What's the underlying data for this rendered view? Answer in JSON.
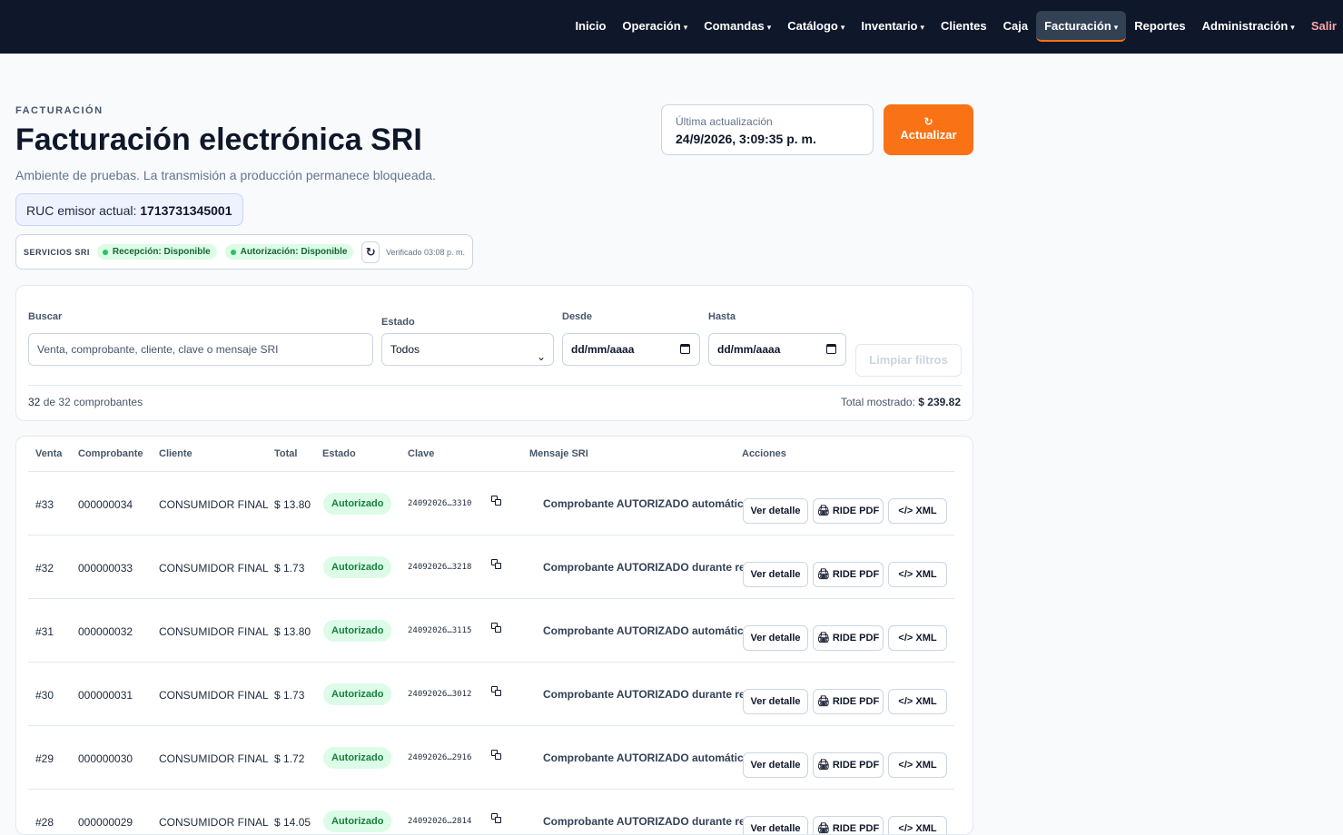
{
  "nav": {
    "items": [
      {
        "label": "Inicio",
        "caret": false
      },
      {
        "label": "Operación",
        "caret": true
      },
      {
        "label": "Comandas",
        "caret": true
      },
      {
        "label": "Catálogo",
        "caret": true
      },
      {
        "label": "Inventario",
        "caret": true
      },
      {
        "label": "Clientes",
        "caret": false
      },
      {
        "label": "Caja",
        "caret": false
      },
      {
        "label": "Facturación",
        "caret": true,
        "active": true
      },
      {
        "label": "Reportes",
        "caret": false
      },
      {
        "label": "Administración",
        "caret": true
      },
      {
        "label": "Salir",
        "caret": false
      }
    ]
  },
  "header": {
    "eyebrow": "FACTURACIÓN",
    "title": "Facturación electrónica SRI",
    "subtitle": "Ambiente de pruebas. La transmisión a producción permanece bloqueada.",
    "last_update_label": "Última actualización",
    "last_update_value": "24/9/2026, 3:09:35 p. m.",
    "refresh_symbol": "↻",
    "refresh_label": "Actualizar"
  },
  "ruc": {
    "label": "RUC emisor actual:",
    "value": "1713731345001"
  },
  "services": {
    "title": "SERVICIOS SRI",
    "reception": "Recepción: Disponible",
    "authorization": "Autorización: Disponible",
    "refresh_symbol": "↻",
    "verified": "Verificado 03:08 p. m."
  },
  "filters": {
    "search_label": "Buscar",
    "search_placeholder": "Venta, comprobante, cliente, clave o mensaje SRI",
    "status_label": "Estado",
    "status_value": "Todos",
    "from_label": "Desde",
    "from_value": "dd/mm/aaaa",
    "to_label": "Hasta",
    "to_value": "dd/mm/aaaa",
    "clear_label": "Limpiar filtros",
    "count_shown": "32",
    "count_rest": "de 32 comprobantes",
    "total_label": "Total mostrado:",
    "total_value": "$ 239.82"
  },
  "table": {
    "headers": {
      "venta": "Venta",
      "comprobante": "Comprobante",
      "cliente": "Cliente",
      "total": "Total",
      "estado": "Estado",
      "clave": "Clave",
      "mensaje": "Mensaje SRI",
      "acciones": "Acciones"
    },
    "actions": {
      "detail": "Ver detalle",
      "ride": "🖨 RIDE PDF",
      "xml": "</> XML"
    },
    "rows": [
      {
        "venta": "#33",
        "comprobante": "000000034",
        "cliente": "CONSUMIDOR FINAL",
        "total": "$ 13.80",
        "estado": "Autorizado",
        "clave": "24092026…3310",
        "mensaje": "Comprobante AUTORIZADO automáticamente"
      },
      {
        "venta": "#32",
        "comprobante": "000000033",
        "cliente": "CONSUMIDOR FINAL",
        "total": "$ 1.73",
        "estado": "Autorizado",
        "clave": "24092026…3218",
        "mensaje": "Comprobante AUTORIZADO durante reintento"
      },
      {
        "venta": "#31",
        "comprobante": "000000032",
        "cliente": "CONSUMIDOR FINAL",
        "total": "$ 13.80",
        "estado": "Autorizado",
        "clave": "24092026…3115",
        "mensaje": "Comprobante AUTORIZADO automáticamente"
      },
      {
        "venta": "#30",
        "comprobante": "000000031",
        "cliente": "CONSUMIDOR FINAL",
        "total": "$ 1.73",
        "estado": "Autorizado",
        "clave": "24092026…3012",
        "mensaje": "Comprobante AUTORIZADO durante reintento"
      },
      {
        "venta": "#29",
        "comprobante": "000000030",
        "cliente": "CONSUMIDOR FINAL",
        "total": "$ 1.72",
        "estado": "Autorizado",
        "clave": "24092026…2916",
        "mensaje": "Comprobante AUTORIZADO automáticamente"
      },
      {
        "venta": "#28",
        "comprobante": "000000029",
        "cliente": "CONSUMIDOR FINAL",
        "total": "$ 14.05",
        "estado": "Autorizado",
        "clave": "24092026…2814",
        "mensaje": "Comprobante AUTORIZADO durante reintento"
      }
    ]
  }
}
